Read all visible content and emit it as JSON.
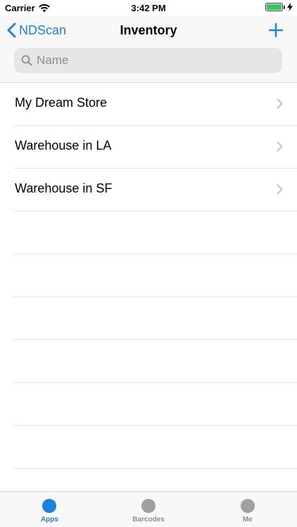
{
  "status_bar": {
    "carrier": "Carrier",
    "time": "3:42 PM"
  },
  "nav": {
    "back_label": "NDScan",
    "title": "Inventory",
    "add_icon": "plus-icon"
  },
  "search": {
    "placeholder": "Name",
    "value": ""
  },
  "list": {
    "items": [
      {
        "label": "My Dream Store"
      },
      {
        "label": "Warehouse in LA"
      },
      {
        "label": "Warehouse in SF"
      }
    ]
  },
  "tab_bar": {
    "tabs": [
      {
        "label": "Apps",
        "active": true
      },
      {
        "label": "Barcodes",
        "active": false
      },
      {
        "label": "Me",
        "active": false
      }
    ]
  },
  "colors": {
    "accent": "#1a82e2",
    "battery": "#34c759",
    "inactive_tab": "#a0a0a0"
  }
}
